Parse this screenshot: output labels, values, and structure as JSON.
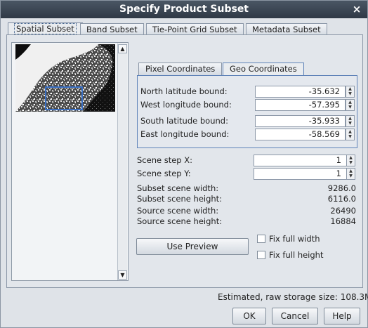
{
  "window": {
    "title": "Specify Product Subset",
    "close_icon": "×"
  },
  "tabs": [
    "Spatial Subset",
    "Band Subset",
    "Tie-Point Grid Subset",
    "Metadata Subset"
  ],
  "subtabs": [
    "Pixel Coordinates",
    "Geo Coordinates"
  ],
  "geo": {
    "north_label": "North latitude bound:",
    "north_value": "-35.632",
    "west_label": "West longitude bound:",
    "west_value": "-57.395",
    "south_label": "South latitude bound:",
    "south_value": "-35.933",
    "east_label": "East longitude bound:",
    "east_value": "-58.569"
  },
  "scene": {
    "step_x_label": "Scene step X:",
    "step_x_value": "1",
    "step_y_label": "Scene step Y:",
    "step_y_value": "1",
    "subset_width_label": "Subset scene width:",
    "subset_width_value": "9286.0",
    "subset_height_label": "Subset scene height:",
    "subset_height_value": "6116.0",
    "source_width_label": "Source scene width:",
    "source_width_value": "26490",
    "source_height_label": "Source scene height:",
    "source_height_value": "16884"
  },
  "actions": {
    "use_preview": "Use Preview",
    "fix_width": "Fix full width",
    "fix_height": "Fix full height"
  },
  "footer": {
    "storage": "Estimated, raw storage size: 108.3M",
    "ok": "OK",
    "cancel": "Cancel",
    "help": "Help"
  }
}
